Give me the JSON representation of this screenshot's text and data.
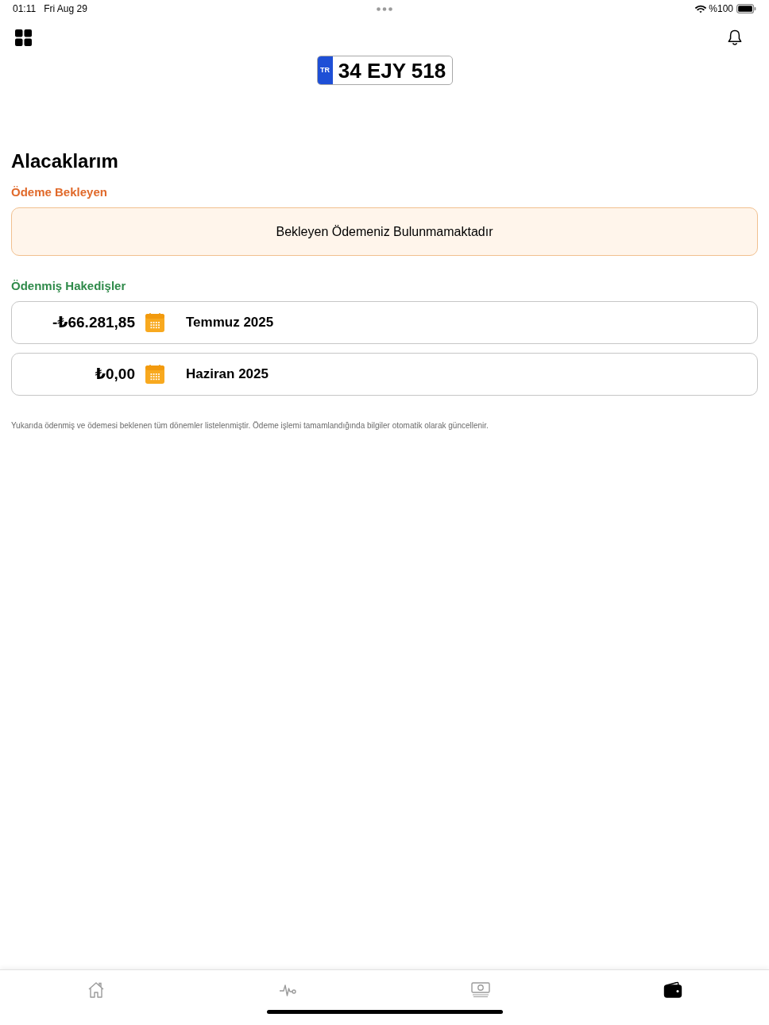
{
  "status_bar": {
    "time": "01:11",
    "date": "Fri Aug 29",
    "battery": "%100"
  },
  "header": {
    "plate": {
      "country": "TR",
      "number": "34 EJY 518"
    }
  },
  "title": "Alacaklarım",
  "pending": {
    "heading": "Ödeme Bekleyen",
    "message": "Bekleyen Ödemeniz Bulunmamaktadır"
  },
  "paid": {
    "heading": "Ödenmiş Hakedişler",
    "items": [
      {
        "amount": "-₺66.281,85",
        "period": "Temmuz 2025"
      },
      {
        "amount": "₺0,00",
        "period": "Haziran 2025"
      }
    ]
  },
  "footnote": "Yukarıda ödenmiş ve ödemesi beklenen tüm dönemler listelenmiştir. Ödeme işlemi tamamlandığında bilgiler otomatik olarak güncellenir.",
  "tab_bar": {
    "tabs": [
      {
        "selected": false
      },
      {
        "selected": false
      },
      {
        "selected": false
      },
      {
        "selected": true
      }
    ]
  }
}
